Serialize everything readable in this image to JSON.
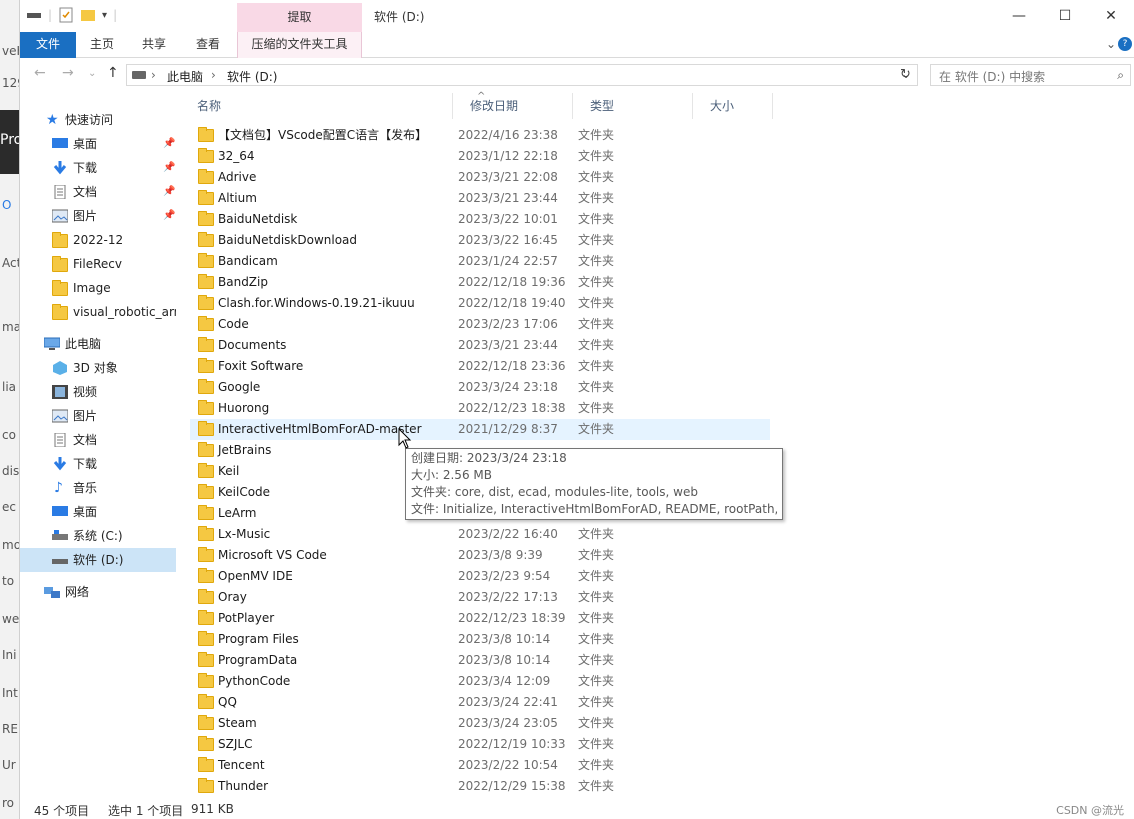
{
  "background_window": {
    "fragments": [
      "veH",
      "129",
      "Pro",
      "O",
      "Act",
      "mas",
      "lia",
      "co",
      "dis",
      "ec",
      "mo",
      "to",
      "we",
      "Ini",
      "Int",
      "RE",
      "Ur",
      "ro"
    ]
  },
  "titlebar": {
    "extract_tab": "提取",
    "title": "软件 (D:)",
    "minimize": "—",
    "maximize": "☐",
    "close": "✕"
  },
  "ribbon": {
    "tabs": {
      "file": "文件",
      "home": "主页",
      "share": "共享",
      "view": "查看",
      "tools": "压缩的文件夹工具"
    },
    "expand": "⌄",
    "help": "?"
  },
  "address": {
    "back": "←",
    "forward": "→",
    "recent": "⌄",
    "up": "↑",
    "segments": [
      "此电脑",
      "软件 (D:)"
    ],
    "separator": "›",
    "dropdown": "⌄",
    "refresh": "↻",
    "search_placeholder": "在 软件 (D:) 中搜索",
    "search_icon": "⌕"
  },
  "nav": {
    "quick_access": "快速访问",
    "items": [
      {
        "label": "桌面",
        "icon": "desktop-icon",
        "pinned": true
      },
      {
        "label": "下载",
        "icon": "download-icon",
        "pinned": true
      },
      {
        "label": "文档",
        "icon": "document-icon",
        "pinned": true
      },
      {
        "label": "图片",
        "icon": "picture-icon",
        "pinned": true
      },
      {
        "label": "2022-12",
        "icon": "folder-icon",
        "pinned": false
      },
      {
        "label": "FileRecv",
        "icon": "folder-icon",
        "pinned": false
      },
      {
        "label": "Image",
        "icon": "folder-icon",
        "pinned": false
      },
      {
        "label": "visual_robotic_arn",
        "icon": "folder-icon",
        "pinned": false
      }
    ],
    "this_pc": "此电脑",
    "pc_items": [
      {
        "label": "3D 对象",
        "icon": "3d-objects-icon"
      },
      {
        "label": "视频",
        "icon": "video-icon"
      },
      {
        "label": "图片",
        "icon": "picture-icon"
      },
      {
        "label": "文档",
        "icon": "document-icon"
      },
      {
        "label": "下载",
        "icon": "download-icon"
      },
      {
        "label": "音乐",
        "icon": "music-icon"
      },
      {
        "label": "桌面",
        "icon": "desktop-icon"
      },
      {
        "label": "系统 (C:)",
        "icon": "drive-icon"
      },
      {
        "label": "软件 (D:)",
        "icon": "drive-icon",
        "selected": true
      }
    ],
    "network": "网络",
    "pin_glyph": "📌"
  },
  "columns": {
    "name": "名称",
    "date": "修改日期",
    "type": "类型",
    "size": "大小",
    "sort_indicator": "^"
  },
  "files": [
    {
      "name": "【文档包】VScode配置C语言【发布】",
      "date": "2022/4/16 23:38",
      "type": "文件夹"
    },
    {
      "name": "32_64",
      "date": "2023/1/12 22:18",
      "type": "文件夹"
    },
    {
      "name": "Adrive",
      "date": "2023/3/21 22:08",
      "type": "文件夹"
    },
    {
      "name": "Altium",
      "date": "2023/3/21 23:44",
      "type": "文件夹"
    },
    {
      "name": "BaiduNetdisk",
      "date": "2023/3/22 10:01",
      "type": "文件夹"
    },
    {
      "name": "BaiduNetdiskDownload",
      "date": "2023/3/22 16:45",
      "type": "文件夹"
    },
    {
      "name": "Bandicam",
      "date": "2023/1/24 22:57",
      "type": "文件夹"
    },
    {
      "name": "BandZip",
      "date": "2022/12/18 19:36",
      "type": "文件夹"
    },
    {
      "name": "Clash.for.Windows-0.19.21-ikuuu",
      "date": "2022/12/18 19:40",
      "type": "文件夹"
    },
    {
      "name": "Code",
      "date": "2023/2/23 17:06",
      "type": "文件夹"
    },
    {
      "name": "Documents",
      "date": "2023/3/21 23:44",
      "type": "文件夹"
    },
    {
      "name": "Foxit Software",
      "date": "2022/12/18 23:36",
      "type": "文件夹"
    },
    {
      "name": "Google",
      "date": "2023/3/24 23:18",
      "type": "文件夹"
    },
    {
      "name": "Huorong",
      "date": "2022/12/23 18:38",
      "type": "文件夹"
    },
    {
      "name": "InteractiveHtmlBomForAD-master",
      "date": "2021/12/29 8:37",
      "type": "文件夹",
      "hover": true
    },
    {
      "name": "JetBrains",
      "date": "",
      "type": ""
    },
    {
      "name": "Keil",
      "date": "",
      "type": ""
    },
    {
      "name": "KeilCode",
      "date": "",
      "type": ""
    },
    {
      "name": "LeArm",
      "date": "",
      "type": ""
    },
    {
      "name": "Lx-Music",
      "date": "2023/2/22 16:40",
      "type": "文件夹"
    },
    {
      "name": "Microsoft VS Code",
      "date": "2023/3/8 9:39",
      "type": "文件夹"
    },
    {
      "name": "OpenMV IDE",
      "date": "2023/2/23 9:54",
      "type": "文件夹"
    },
    {
      "name": "Oray",
      "date": "2023/2/22 17:13",
      "type": "文件夹"
    },
    {
      "name": "PotPlayer",
      "date": "2022/12/23 18:39",
      "type": "文件夹"
    },
    {
      "name": "Program Files",
      "date": "2023/3/8 10:14",
      "type": "文件夹"
    },
    {
      "name": "ProgramData",
      "date": "2023/3/8 10:14",
      "type": "文件夹"
    },
    {
      "name": "PythonCode",
      "date": "2023/3/4 12:09",
      "type": "文件夹"
    },
    {
      "name": "QQ",
      "date": "2023/3/24 22:41",
      "type": "文件夹"
    },
    {
      "name": "Steam",
      "date": "2023/3/24 23:05",
      "type": "文件夹"
    },
    {
      "name": "SZJLC",
      "date": "2022/12/19 10:33",
      "type": "文件夹"
    },
    {
      "name": "Tencent",
      "date": "2023/2/22 10:54",
      "type": "文件夹"
    },
    {
      "name": "Thunder",
      "date": "2022/12/29 15:38",
      "type": "文件夹"
    }
  ],
  "tooltip": {
    "created": "创建日期: 2023/3/24 23:18",
    "size": "大小: 2.56 MB",
    "folders": "文件夹: core, dist, ecad, modules-lite, tools, web",
    "files": "文件: Initialize, InteractiveHtmlBomForAD, README, rootPath, ..."
  },
  "status": {
    "count": "45 个项目",
    "selected": "选中 1 个项目",
    "size": "911 KB",
    "watermark": "CSDN @流光"
  },
  "colors": {
    "accent": "#1a6fc2",
    "tools_tab": "#f9d9e6",
    "selection": "#cce4f7",
    "hover": "#e5f3ff",
    "folder": "#f5c842"
  }
}
